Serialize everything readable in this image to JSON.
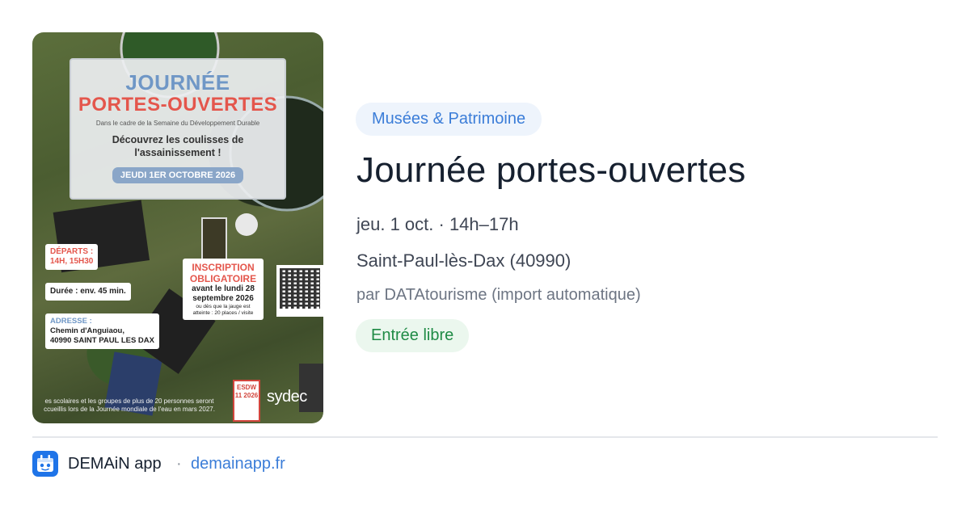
{
  "poster": {
    "title_line1": "JOURNÉE",
    "title_line2": "PORTES-OUVERTES",
    "subtitle": "Dans le cadre de la Semaine du Développement Durable",
    "tagline_line1": "Découvrez les coulisses de",
    "tagline_line2": "l'assainissement !",
    "date_badge": "JEUDI 1ER OCTOBRE 2026",
    "departs_label": "DÉPARTS :",
    "departs_value": "14H, 15H30",
    "duration": "Durée : env. 45 min.",
    "address_label": "ADRESSE :",
    "address_line1": "Chemin d'Anguiaou,",
    "address_line2": "40990 SAINT PAUL LES DAX",
    "inscription_line1": "INSCRIPTION",
    "inscription_line2": "OBLIGATOIRE",
    "inscription_deadline_1": "avant le lundi 28",
    "inscription_deadline_2": "septembre 2026",
    "inscription_note_1": "ou dès que la jauge est",
    "inscription_note_2": "atteinte : 20 places / visite",
    "esdw_logo": "ESDW 11 2026",
    "sydec_logo": "sydec",
    "footer_line1": "es scolaires et les groupes de plus de 20 personnes seront",
    "footer_line2": "ccueillis lors de la Journée mondiale de l'eau en mars 2027."
  },
  "event": {
    "category": "Musées & Patrimoine",
    "title": "Journée portes-ouvertes",
    "datetime": "jeu. 1 oct. · 14h–17h",
    "location": "Saint-Paul-lès-Dax (40990)",
    "organizer": "par DATAtourisme (import automatique)",
    "price": "Entrée libre"
  },
  "footer": {
    "app_icon": "app-logo-icon",
    "app_name": "DEMAiN app",
    "separator": "·",
    "url": "demainapp.fr"
  },
  "colors": {
    "accent_blue": "#3b7dd8",
    "category_bg": "#eef4fc",
    "price_green": "#1f8b45",
    "price_bg": "#ebf7ee",
    "title": "#16202f"
  }
}
